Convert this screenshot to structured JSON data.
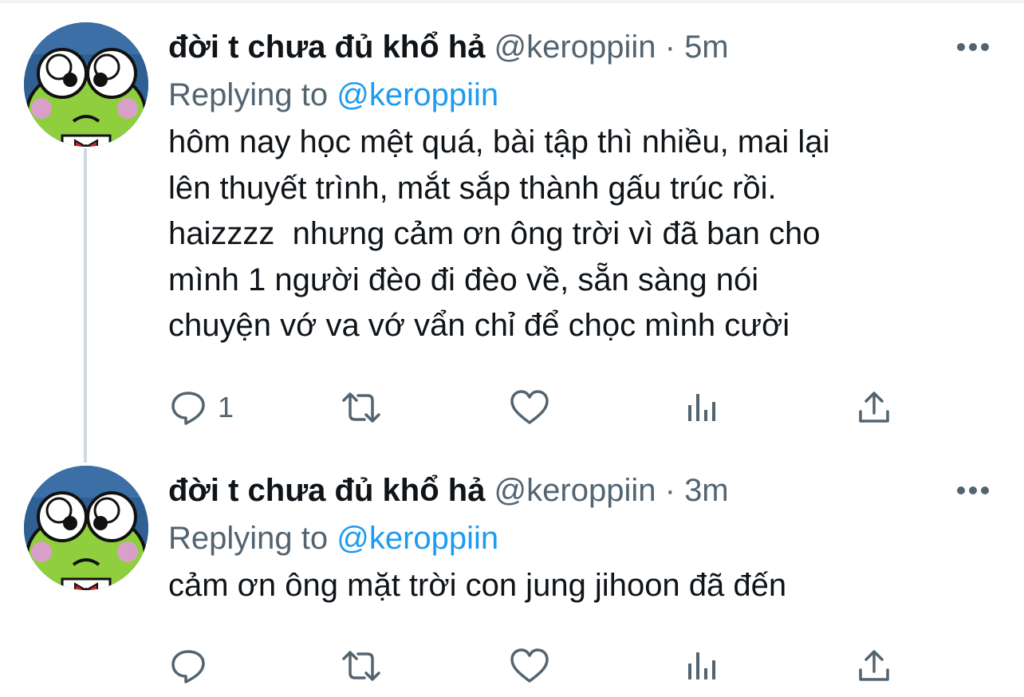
{
  "colors": {
    "text": "#0f1419",
    "secondary": "#536471",
    "accent": "#1d9bf0",
    "thread_line": "#cfd9de"
  },
  "tweets": [
    {
      "display_name": "đời t chưa đủ khổ hả",
      "handle": "@keroppiin",
      "separator": "·",
      "time": "5m",
      "replying_prefix": "Replying to",
      "replying_to": "@keroppiin",
      "text": "hôm nay học mệt quá, bài tập thì nhiều, mai lại\nlên thuyết trình, mắt sắp thành gấu trúc rồi.\nhaizzzz  nhưng cảm ơn ông trời vì đã ban cho\nmình 1 người đèo đi đèo về, sẵn sàng nói\nchuyện vớ va vớ vẩn chỉ để chọc mình cười",
      "reply_count": "1",
      "icons": [
        "reply-icon",
        "retweet-icon",
        "like-icon",
        "views-icon",
        "share-icon",
        "more-icon"
      ]
    },
    {
      "display_name": "đời t chưa đủ khổ hả",
      "handle": "@keroppiin",
      "separator": "·",
      "time": "3m",
      "replying_prefix": "Replying to",
      "replying_to": "@keroppiin",
      "text": "cảm ơn ông mặt trời con jung jihoon đã đến",
      "reply_count": "",
      "icons": [
        "reply-icon",
        "retweet-icon",
        "like-icon",
        "views-icon",
        "share-icon",
        "more-icon"
      ]
    }
  ]
}
